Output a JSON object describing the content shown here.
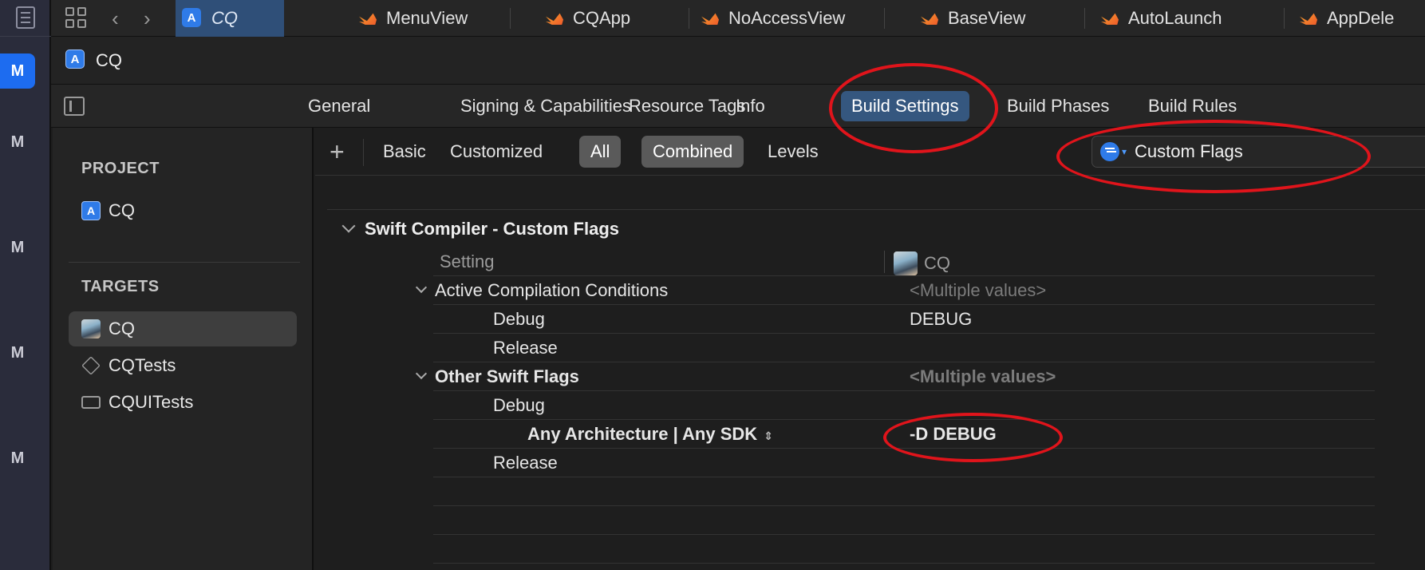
{
  "tabbar": {
    "tabs": [
      {
        "label": "CQ",
        "kind": "project"
      },
      {
        "label": "MenuView",
        "kind": "swift"
      },
      {
        "label": "CQApp",
        "kind": "swift"
      },
      {
        "label": "NoAccessView",
        "kind": "swift"
      },
      {
        "label": "BaseView",
        "kind": "swift"
      },
      {
        "label": "AutoLaunch",
        "kind": "swift"
      },
      {
        "label": "AppDele",
        "kind": "swift"
      }
    ]
  },
  "leftstrip": {
    "letters": [
      "M",
      "M",
      "M",
      "M",
      "M"
    ]
  },
  "project": {
    "title": "CQ"
  },
  "editor_tabs": [
    "General",
    "Signing & Capabilities",
    "Resource Tags",
    "Info",
    "Build Settings",
    "Build Phases",
    "Build Rules"
  ],
  "sidebar": {
    "project_header": "PROJECT",
    "project_item": "CQ",
    "targets_header": "TARGETS",
    "targets": [
      "CQ",
      "CQTests",
      "CQUITests"
    ]
  },
  "filterbar": {
    "add": "+",
    "filters": [
      "Basic",
      "Customized",
      "All",
      "Combined",
      "Levels"
    ],
    "search_value": "Custom Flags"
  },
  "section": {
    "title": "Swift Compiler - Custom Flags"
  },
  "table": {
    "header_setting": "Setting",
    "header_target": "CQ",
    "rows": {
      "acc_label": "Active Compilation Conditions",
      "acc_value": "<Multiple values>",
      "acc_debug_label": "Debug",
      "acc_debug_value": "DEBUG",
      "acc_release_label": "Release",
      "osf_label": "Other Swift Flags",
      "osf_value": "<Multiple values>",
      "osf_debug_label": "Debug",
      "osf_arch_label": "Any Architecture | Any SDK",
      "osf_arch_value": "-D DEBUG",
      "osf_release_label": "Release"
    }
  },
  "colors": {
    "accent": "#2f7be8",
    "selected_tab": "#35577f",
    "annotation": "#e0141b"
  }
}
